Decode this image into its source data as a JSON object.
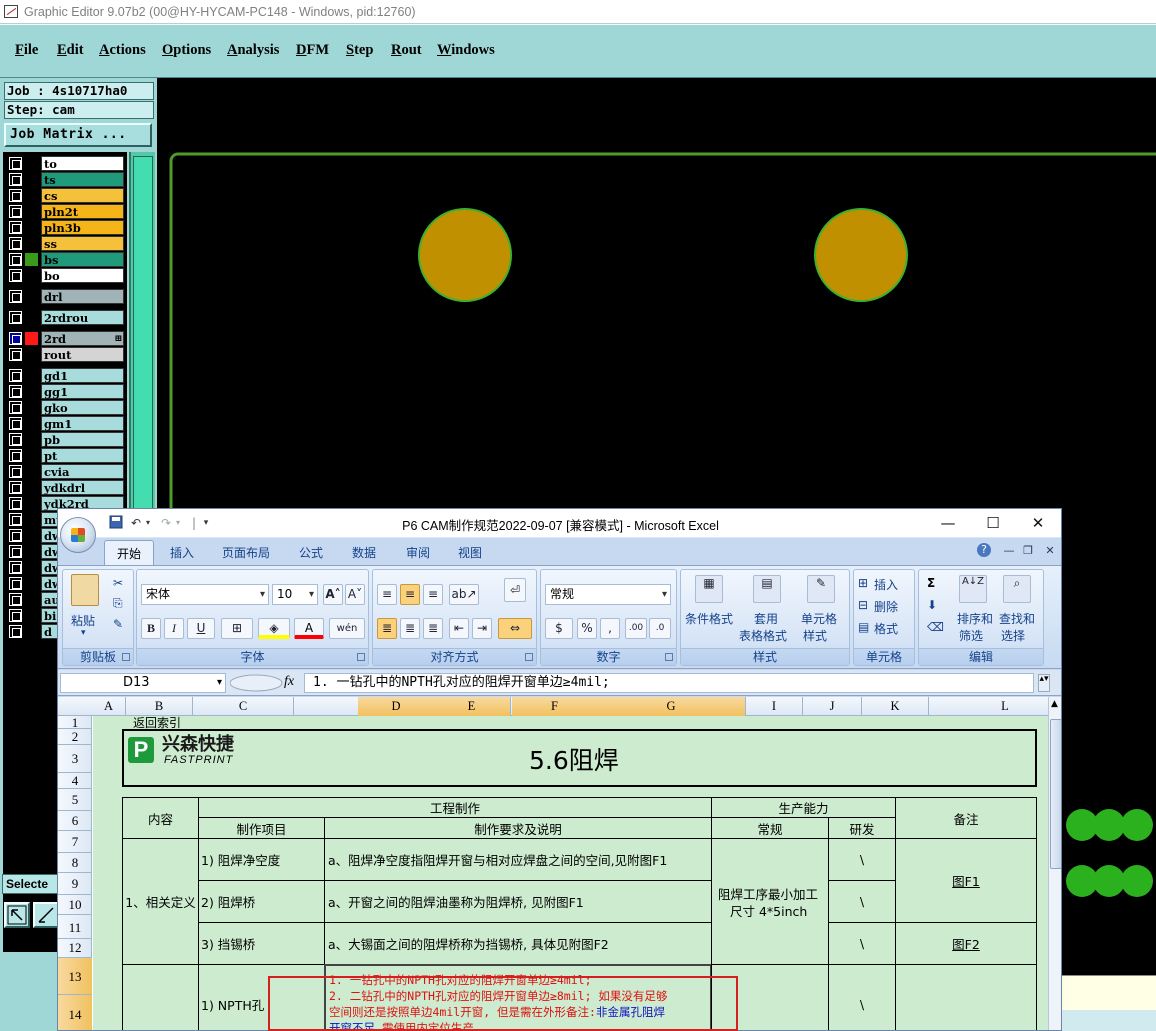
{
  "editor": {
    "title": "Graphic Editor 9.07b2 (00@HY-HYCAM-PC148 - Windows, pid:12760)",
    "menu": [
      "File",
      "Edit",
      "Actions",
      "Options",
      "Analysis",
      "DFM",
      "Step",
      "Rout",
      "Windows"
    ],
    "job_label": "Job : 4s10717ha0",
    "step_label": "Step: cam",
    "job_matrix_button": "Job Matrix ...",
    "selected_label": "Selecte",
    "layers": [
      {
        "name": "to",
        "color": "#ffffff",
        "sel_color": "#000000"
      },
      {
        "name": "ts",
        "color": "#1f9a7a",
        "sel_color": "#000000"
      },
      {
        "name": "cs",
        "color": "#f5c13a",
        "sel_color": "#000000"
      },
      {
        "name": "pln2t",
        "color": "#f5b417",
        "sel_color": "#000000"
      },
      {
        "name": "pln3b",
        "color": "#f5b417",
        "sel_color": "#000000"
      },
      {
        "name": "ss",
        "color": "#f5c13a",
        "sel_color": "#000000"
      },
      {
        "name": "bs",
        "color": "#1f9a7a",
        "sel_color": "#3a9a1a"
      },
      {
        "name": "bo",
        "color": "#ffffff",
        "sel_color": "#000000"
      },
      {
        "name": "drl",
        "color": "#a0b4b8",
        "sel_color": "#000000"
      },
      {
        "name": "2rdrou",
        "color": "#a8dcdc",
        "sel_color": "#000000"
      },
      {
        "name": "2rd",
        "color": "#a0b4b8",
        "sel_color": "#ff1a1a"
      },
      {
        "name": "rout",
        "color": "#d4d4d4",
        "sel_color": "#000000"
      },
      {
        "name": "gd1",
        "color": "#a8dcdc",
        "sel_color": "#000000"
      },
      {
        "name": "gg1",
        "color": "#a8dcdc",
        "sel_color": "#000000"
      },
      {
        "name": "gko",
        "color": "#a8dcdc",
        "sel_color": "#000000"
      },
      {
        "name": "gm1",
        "color": "#a8dcdc",
        "sel_color": "#000000"
      },
      {
        "name": "pb",
        "color": "#a8dcdc",
        "sel_color": "#000000"
      },
      {
        "name": "pt",
        "color": "#a8dcdc",
        "sel_color": "#000000"
      },
      {
        "name": "cvia",
        "color": "#a8dcdc",
        "sel_color": "#000000"
      },
      {
        "name": "ydkdrl",
        "color": "#a8dcdc",
        "sel_color": "#000000"
      },
      {
        "name": "ydk2rd",
        "color": "#a8dcdc",
        "sel_color": "#000000"
      },
      {
        "name": "mp",
        "color": "#a8dcdc",
        "sel_color": "#000000"
      },
      {
        "name": "dw",
        "color": "#a8dcdc",
        "sel_color": "#000000"
      },
      {
        "name": "dw",
        "color": "#a8dcdc",
        "sel_color": "#000000"
      },
      {
        "name": "dw",
        "color": "#a8dcdc",
        "sel_color": "#000000"
      },
      {
        "name": "dw",
        "color": "#a8dcdc",
        "sel_color": "#000000"
      },
      {
        "name": "au",
        "color": "#a8dcdc",
        "sel_color": "#000000"
      },
      {
        "name": "bi",
        "color": "#a8dcdc",
        "sel_color": "#000000"
      },
      {
        "name": "d",
        "color": "#a8dcdc",
        "sel_color": "#000000"
      }
    ],
    "canvas_colors": {
      "pad": "#c09000",
      "pad_edge": "#3cb030",
      "outline": "#4f9a2a",
      "dots": "#2bb01e"
    }
  },
  "excel": {
    "title": "P6 CAM制作规范2022-09-07  [兼容模式] - Microsoft Excel",
    "window_controls": [
      "—",
      "☐",
      "✕"
    ],
    "tabs": [
      "开始",
      "插入",
      "页面布局",
      "公式",
      "数据",
      "审阅",
      "视图"
    ],
    "active_tab": "开始",
    "ribbon": {
      "paste": "粘贴",
      "font_name": "宋体",
      "font_size": "10",
      "number_format": "常规",
      "conditional_format": "条件格式",
      "table_format_1": "套用",
      "table_format_2": "表格格式",
      "cell_style_1": "单元格",
      "cell_style_2": "样式",
      "insert": "插入",
      "delete": "删除",
      "format": "格式",
      "sort_1": "排序和",
      "sort_2": "筛选",
      "find_1": "查找和",
      "find_2": "选择",
      "groups": [
        "剪贴板",
        "字体",
        "对齐方式",
        "数字",
        "样式",
        "单元格",
        "编辑"
      ]
    },
    "name_box": "D13",
    "fx": "fx",
    "formula": "1. 一钻孔中的NPTH孔对应的阻焊开窗单边≥4mil;",
    "columns": [
      "A",
      "B",
      "C",
      "D",
      "E",
      "F",
      "G",
      "I",
      "J",
      "K",
      "L"
    ],
    "rows": [
      "1",
      "2",
      "3",
      "4",
      "5",
      "6",
      "7",
      "8",
      "9",
      "10",
      "11",
      "12",
      "13",
      "14"
    ],
    "sheet": {
      "back_link": "返回索引",
      "logo_cn": "兴森快捷",
      "logo_en": "FASTPRINT",
      "heading": "5.6阻焊",
      "hdr_content": "内容",
      "hdr_engineering": "工程制作",
      "hdr_capability": "生产能力",
      "hdr_remarks": "备注",
      "hdr_item": "制作项目",
      "hdr_requirement": "制作要求及说明",
      "hdr_normal": "常规",
      "hdr_rnd": "研发",
      "section1": "1、相关定义",
      "item1": "1) 阻焊净空度",
      "req1": "a、阻焊净空度指阻焊开窗与相对应焊盘之间的空间,见附图F1",
      "item2": "2) 阻焊桥",
      "req2": "a、开窗之间的阻焊油墨称为阻焊桥, 见附图F1",
      "item3": "3) 挡锡桥",
      "req3": "a、大锡面之间的阻焊桥称为挡锡桥, 具体见附图F2",
      "capability_line1": "阻焊工序最小加工",
      "capability_line2": "尺寸 4*5inch",
      "rnd_mark": "\\",
      "link_f1": "图F1",
      "link_f2": "图F2",
      "item_npth": "1) NPTH孔",
      "npth_line1": "1. 一钻孔中的NPTH孔对应的阻焊开窗单边≥4mil;",
      "npth_line2": "2. 二钻孔中的NPTH孔对应的阻焊开窗单边≥8mil; 如果没有足够",
      "npth_line3a": "空间则还是按照单边4mil开窗, 但是需在外形备注: ",
      "npth_line3b": "非金属孔阻焊",
      "npth_line4a": "开窗不足, ",
      "npth_line4b": "需使用内定位生产。"
    }
  }
}
